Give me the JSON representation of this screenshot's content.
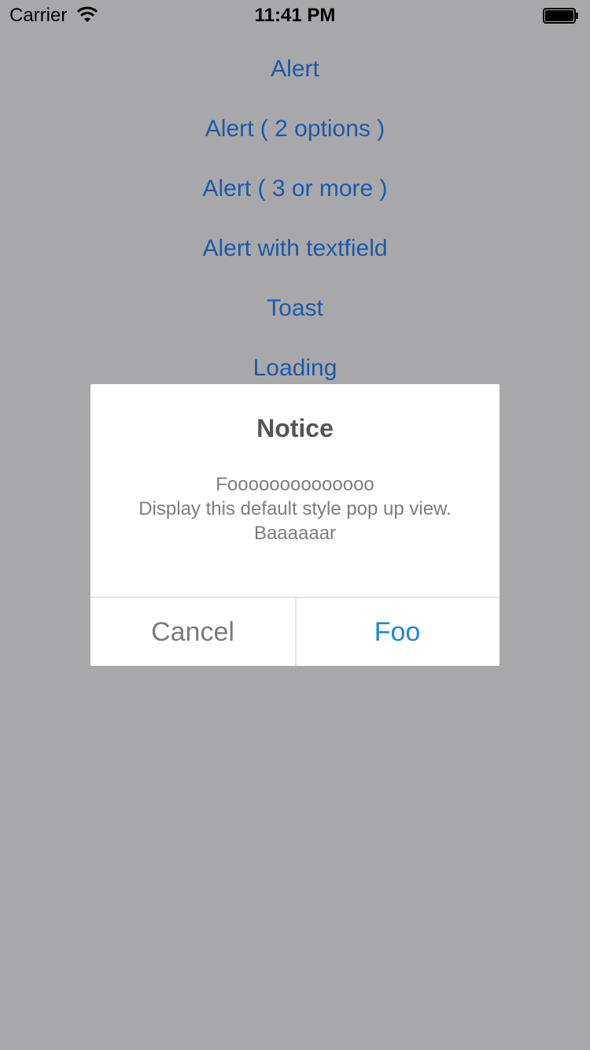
{
  "status_bar": {
    "carrier": "Carrier",
    "time": "11:41 PM",
    "wifi_icon": "wifi-icon",
    "battery_icon": "battery-icon"
  },
  "menu": {
    "items": [
      {
        "label": "Alert"
      },
      {
        "label": "Alert ( 2 options )"
      },
      {
        "label": "Alert ( 3 or more )"
      },
      {
        "label": "Alert with textfield"
      },
      {
        "label": "Toast"
      },
      {
        "label": "Loading"
      }
    ],
    "color": "#1d5aa8"
  },
  "dialog": {
    "title": "Notice",
    "message_lines": [
      "Foooooooooooooo",
      "Display this default style pop up view.",
      "Baaaaaar"
    ],
    "cancel_label": "Cancel",
    "confirm_label": "Foo",
    "confirm_color": "#1c86d6"
  },
  "colors": {
    "background_overlay": "#a8a8aa",
    "dialog_background": "#ffffff"
  }
}
